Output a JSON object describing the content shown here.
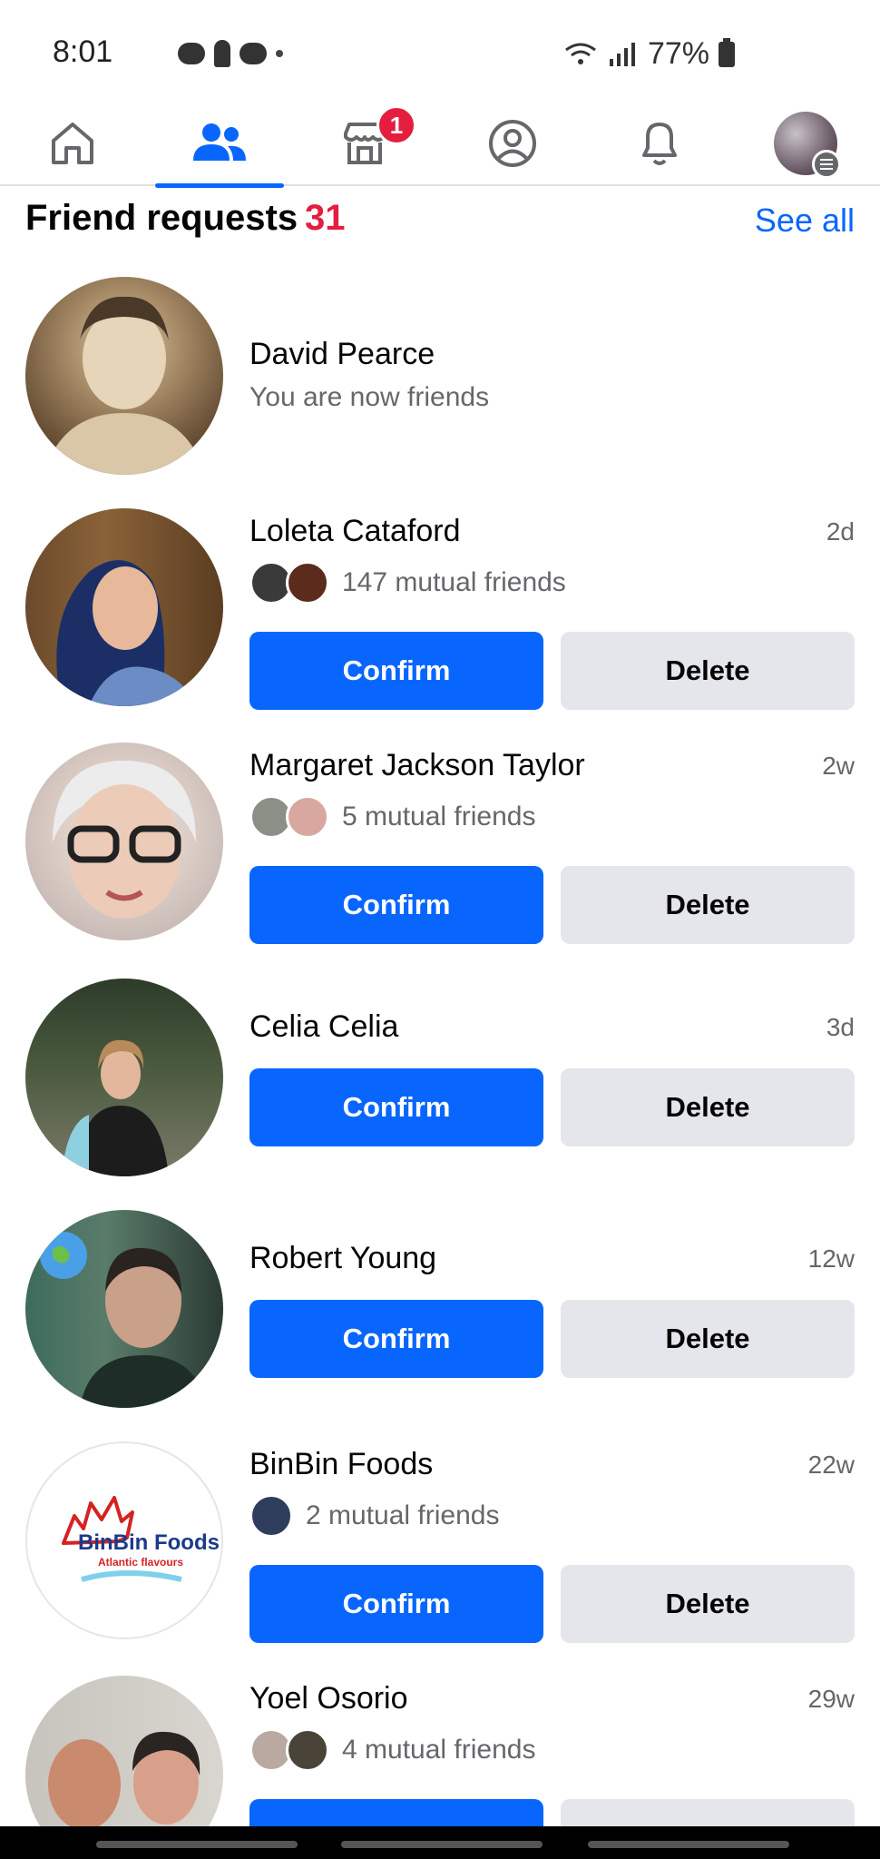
{
  "status_bar": {
    "time": "8:01",
    "battery": "77%"
  },
  "nav": {
    "items": [
      {
        "name": "home"
      },
      {
        "name": "friends",
        "active": true
      },
      {
        "name": "marketplace",
        "badge": "1"
      },
      {
        "name": "profile"
      },
      {
        "name": "notifications"
      },
      {
        "name": "menu"
      }
    ]
  },
  "header": {
    "title": "Friend requests",
    "count": "31",
    "see_all": "See all"
  },
  "buttons": {
    "confirm": "Confirm",
    "delete": "Delete"
  },
  "requests": [
    {
      "name": "David Pearce",
      "status": "You are now friends"
    },
    {
      "name": "Loleta Cataford",
      "time": "2d",
      "mutual": "147 mutual friends"
    },
    {
      "name": "Margaret Jackson Taylor",
      "time": "2w",
      "mutual": "5 mutual friends"
    },
    {
      "name": "Celia Celia",
      "time": "3d"
    },
    {
      "name": "Robert Young",
      "time": "12w"
    },
    {
      "name": "BinBin Foods",
      "time": "22w",
      "mutual": "2 mutual friends",
      "logo_text": "BinBin Foods",
      "logo_sub": "Atlantic flavours"
    },
    {
      "name": "Yoel Osorio",
      "time": "29w",
      "mutual": "4 mutual friends"
    }
  ],
  "colors": {
    "accent": "#0866ff",
    "badge": "#e41e3f",
    "muted": "#65676b",
    "secondary_button": "#e4e6eb"
  }
}
